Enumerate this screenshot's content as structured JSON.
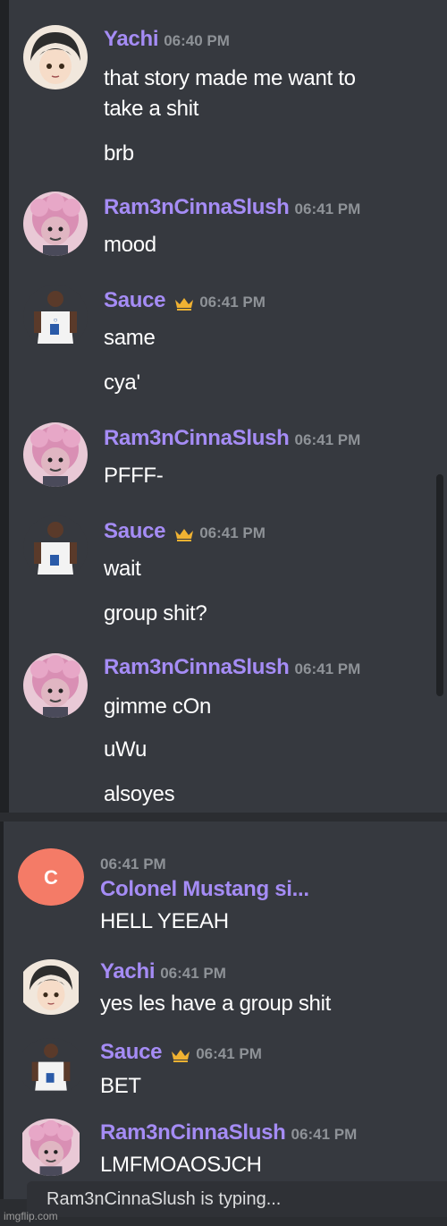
{
  "messages": [
    {
      "author": "Yachi",
      "time": "06:40 PM",
      "crown": false,
      "avatar": "yachi-avatar",
      "lines": [
        "that story made me want to",
        "take a shit",
        "brb"
      ]
    },
    {
      "author": "Ram3nCinnaSlush",
      "time": "06:41 PM",
      "crown": false,
      "avatar": "pink-hair-avatar",
      "lines": [
        "mood"
      ]
    },
    {
      "author": "Sauce",
      "time": "06:41 PM",
      "crown": true,
      "avatar": "basketball-player-avatar",
      "lines": [
        "same",
        "cya'"
      ]
    },
    {
      "author": "Ram3nCinnaSlush",
      "time": "06:41 PM",
      "crown": false,
      "avatar": "pink-hair-avatar",
      "lines": [
        "PFFF-"
      ]
    },
    {
      "author": "Sauce",
      "time": "06:41 PM",
      "crown": true,
      "avatar": "basketball-player-avatar",
      "lines": [
        "wait",
        "group shit?"
      ]
    },
    {
      "author": "Ram3nCinnaSlush",
      "time": "06:41 PM",
      "crown": false,
      "avatar": "pink-hair-avatar",
      "lines": [
        "gimme cOn",
        "uWu",
        "alsoyes"
      ]
    }
  ],
  "messages_bottom": [
    {
      "author": "Colonel Mustang si...",
      "time": "06:41 PM",
      "crown": false,
      "avatar": "letter-c-avatar",
      "avatar_letter": "C",
      "lines": [
        "HELL YEEAH"
      ]
    },
    {
      "author": "Yachi",
      "time": "06:41 PM",
      "crown": false,
      "avatar": "yachi-avatar",
      "lines": [
        "yes les have a group shit"
      ]
    },
    {
      "author": "Sauce",
      "time": "06:41 PM",
      "crown": true,
      "avatar": "basketball-player-avatar",
      "lines": [
        "BET"
      ]
    },
    {
      "author": "Ram3nCinnaSlush",
      "time": "06:41 PM",
      "crown": false,
      "avatar": "pink-hair-avatar",
      "lines": [
        "LMFMOAOSJCH"
      ]
    }
  ],
  "typing": {
    "user": "Ram3nCinnaSlush",
    "suffix": " is typing..."
  },
  "watermark": "imgflip.com",
  "colors": {
    "username": "#a58cf5",
    "background": "#36393f",
    "timestamp": "#8e9297",
    "crown": "#f0b232",
    "avatar_c": "#f47b67"
  }
}
